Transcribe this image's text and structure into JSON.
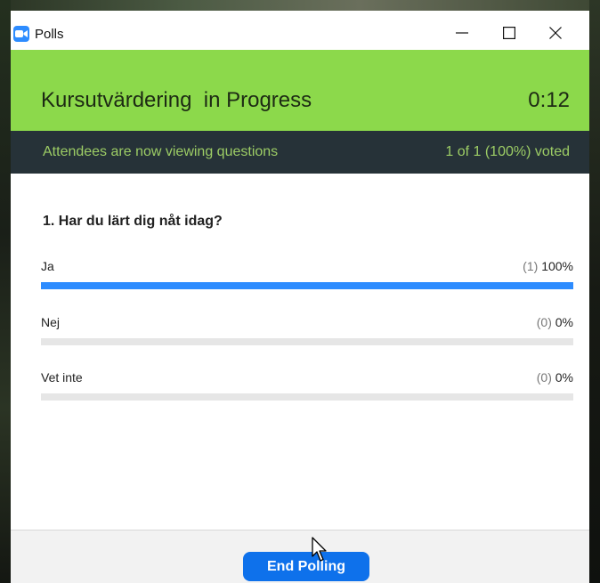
{
  "window": {
    "title": "Polls",
    "icon": "zoom-camera-icon"
  },
  "window_controls": {
    "minimize": "minimize-icon",
    "maximize": "maximize-icon",
    "close": "close-icon"
  },
  "header": {
    "poll_title": "Kursutvärdering  in Progress",
    "timer": "0:12",
    "background_color": "#8cd94b"
  },
  "status": {
    "left_text": "Attendees are now viewing questions",
    "right_text": "1 of 1 (100%) voted",
    "background_color": "#263238",
    "text_color": "#9ccc65"
  },
  "question": {
    "text": "1. Har du lärt dig nåt idag?",
    "answers": [
      {
        "label": "Ja",
        "count": "(1)",
        "percent": "100%",
        "fraction": 1.0
      },
      {
        "label": "Nej",
        "count": "(0)",
        "percent": "0%",
        "fraction": 0.0
      },
      {
        "label": "Vet inte",
        "count": "(0)",
        "percent": "0%",
        "fraction": 0.0
      }
    ],
    "bar_color": "#2d8cff"
  },
  "footer": {
    "end_button_label": "End Polling",
    "button_color": "#0e71eb"
  }
}
